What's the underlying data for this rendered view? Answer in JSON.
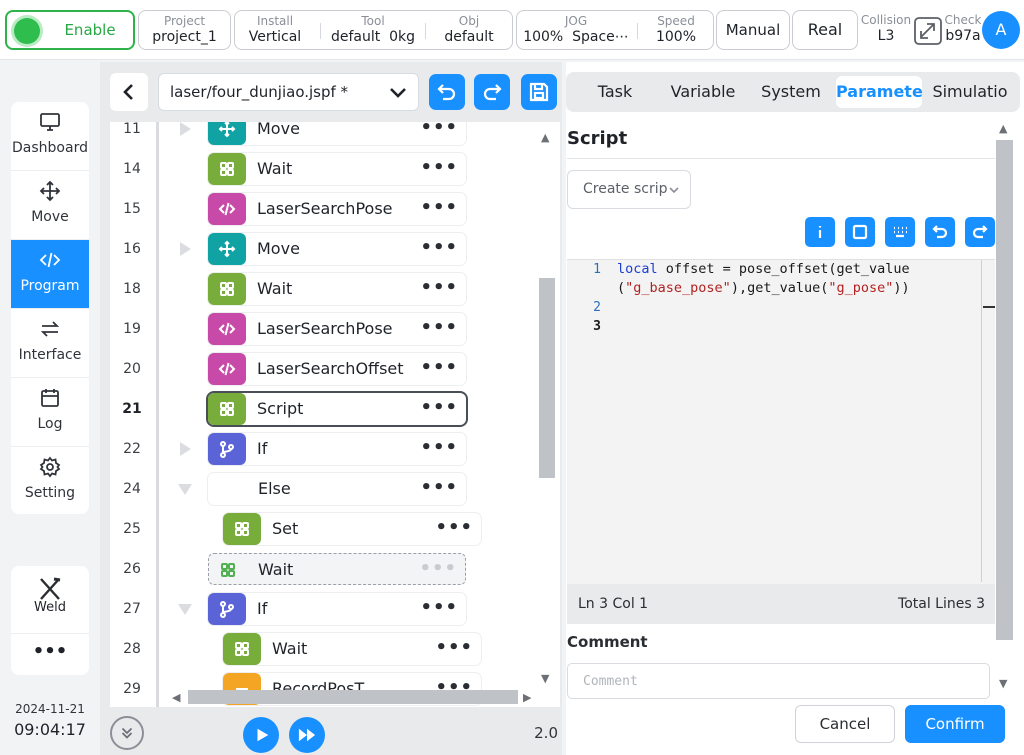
{
  "topbar": {
    "enable": "Enable",
    "project": {
      "label": "Project",
      "value": "project_1"
    },
    "install": {
      "label": "Install",
      "value": "Vertical"
    },
    "tool": {
      "label": "Tool",
      "value": "default",
      "value2": "0kg"
    },
    "obj": {
      "label": "Obj",
      "value": "default"
    },
    "jog": {
      "label": "JOG",
      "value": "100%",
      "value2": "Space⋯"
    },
    "speed": {
      "label": "Speed",
      "value": "100%"
    },
    "manual": "Manual",
    "real": "Real",
    "collision": {
      "label": "Collision",
      "value": "L3"
    },
    "check": {
      "label": "Check",
      "value": "b97a"
    },
    "avatar": "A",
    "colors": {
      "enable": "#2fbd4d",
      "accent": "#1890ff"
    }
  },
  "nav": {
    "items": [
      {
        "label": "Dashboard",
        "icon": "monitor-icon"
      },
      {
        "label": "Move",
        "icon": "move-arrows-icon"
      },
      {
        "label": "Program",
        "icon": "code-icon"
      },
      {
        "label": "Interface",
        "icon": "swap-icon"
      },
      {
        "label": "Log",
        "icon": "calendar-icon"
      },
      {
        "label": "Setting",
        "icon": "gear-icon"
      }
    ],
    "weld": "Weld",
    "more": "•••",
    "date": "2024-11-21",
    "time": "09:04:17"
  },
  "program": {
    "file": "laser/four_dunjiao.jspf *",
    "rows": [
      {
        "line": "11",
        "name": "Move",
        "type": "move"
      },
      {
        "line": "14",
        "name": "Wait",
        "type": "wait"
      },
      {
        "line": "15",
        "name": "LaserSearchPose",
        "type": "script"
      },
      {
        "line": "16",
        "name": "Move",
        "type": "move"
      },
      {
        "line": "18",
        "name": "Wait",
        "type": "wait"
      },
      {
        "line": "19",
        "name": "LaserSearchPose",
        "type": "script"
      },
      {
        "line": "20",
        "name": "LaserSearchOffset",
        "type": "script"
      },
      {
        "line": "21",
        "name": "Script",
        "type": "wait"
      },
      {
        "line": "22",
        "name": "If",
        "type": "if"
      },
      {
        "line": "24",
        "name": "Else",
        "type": "else"
      },
      {
        "line": "25",
        "name": "Set",
        "type": "wait"
      },
      {
        "line": "26",
        "name": "Wait",
        "type": "wait"
      },
      {
        "line": "27",
        "name": "If",
        "type": "if"
      },
      {
        "line": "28",
        "name": "Wait",
        "type": "wait"
      },
      {
        "line": "29",
        "name": "RecordPosT",
        "type": "record"
      }
    ],
    "speed": "2.0"
  },
  "right": {
    "tabs": [
      "Task",
      "Variable",
      "System",
      "Paramete",
      "Simulatio"
    ],
    "active_tab": "Paramete",
    "title": "Script",
    "create_placeholder": "Create scrip",
    "code": {
      "l1_num": "1",
      "l2_num": "2",
      "l3_num": "3",
      "kw": "local",
      "l1a": " offset = pose_offset(get_value",
      "l1b_open": "(",
      "str1": "\"g_base_pose\"",
      "l1b_mid": "),get_value(",
      "str2": "\"g_pose\"",
      "l1b_close": "))"
    },
    "status_left": "Ln 3 Col 1",
    "status_right": "Total Lines 3",
    "comment_label": "Comment",
    "comment_placeholder": "Comment",
    "cancel": "Cancel",
    "confirm": "Confirm"
  }
}
